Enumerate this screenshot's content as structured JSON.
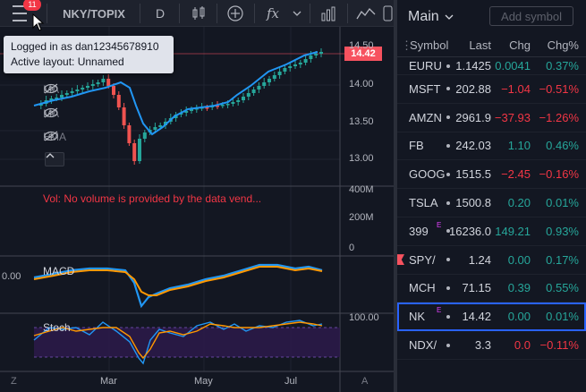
{
  "toolbar": {
    "menu_badge": "11",
    "symbol": "NKY/TOPIX",
    "interval": "D"
  },
  "tooltip": {
    "line1": "Logged in as dan12345678910",
    "line2": "Active layout: Unnamed"
  },
  "chart": {
    "price_axis": [
      "14.50",
      "14.00",
      "13.50",
      "13.00"
    ],
    "last_price": "14.42",
    "volume_axis": [
      "400M",
      "200M",
      "0"
    ],
    "macd_axis": "0.00",
    "stoch_axis": "100.00",
    "time_axis": [
      "Mar",
      "May",
      "Jul"
    ],
    "bottom_left": "Z",
    "bottom_right": "A",
    "indicators": [
      "MA",
      "MA",
      "EMA"
    ],
    "volume_message": "Vol: No volume is provided by the data vend...",
    "macd_label": "MACD",
    "stoch_label": "Stoch",
    "colors": {
      "up": "#26a69a",
      "down": "#ef5350",
      "ma": "#2196f3",
      "signal": "#ff9800"
    }
  },
  "watchlist": {
    "title": "Main",
    "add_symbol": "Add symbol",
    "columns": {
      "symbol": "Symbol",
      "last": "Last",
      "chg": "Chg",
      "chgp": "Chg%"
    },
    "rows": [
      {
        "symbol": "EURU",
        "last": "1.1425",
        "chg": "0.0041",
        "chgp": "0.37%",
        "dir": "pos"
      },
      {
        "symbol": "MSFT",
        "last": "202.88",
        "chg": "−1.04",
        "chgp": "−0.51%",
        "dir": "neg"
      },
      {
        "symbol": "AMZN",
        "last": "2961.9",
        "chg": "−37.93",
        "chgp": "−1.26%",
        "dir": "neg"
      },
      {
        "symbol": "FB",
        "last": "242.03",
        "chg": "1.10",
        "chgp": "0.46%",
        "dir": "pos"
      },
      {
        "symbol": "GOOG",
        "last": "1515.5",
        "chg": "−2.45",
        "chgp": "−0.16%",
        "dir": "neg"
      },
      {
        "symbol": "TSLA",
        "last": "1500.8",
        "chg": "0.20",
        "chgp": "0.01%",
        "dir": "pos"
      },
      {
        "symbol": "399",
        "last": "16236.0",
        "chg": "149.21",
        "chgp": "0.93%",
        "dir": "pos"
      },
      {
        "symbol": "SPY/",
        "last": "1.24",
        "chg": "0.00",
        "chgp": "0.17%",
        "dir": "pos"
      },
      {
        "symbol": "MCH",
        "last": "71.15",
        "chg": "0.39",
        "chgp": "0.55%",
        "dir": "pos"
      },
      {
        "symbol": "NK",
        "last": "14.42",
        "chg": "0.00",
        "chgp": "0.01%",
        "dir": "pos"
      },
      {
        "symbol": "NDX/",
        "last": "3.3",
        "chg": "0.0",
        "chgp": "−0.11%",
        "dir": "neg"
      }
    ]
  }
}
